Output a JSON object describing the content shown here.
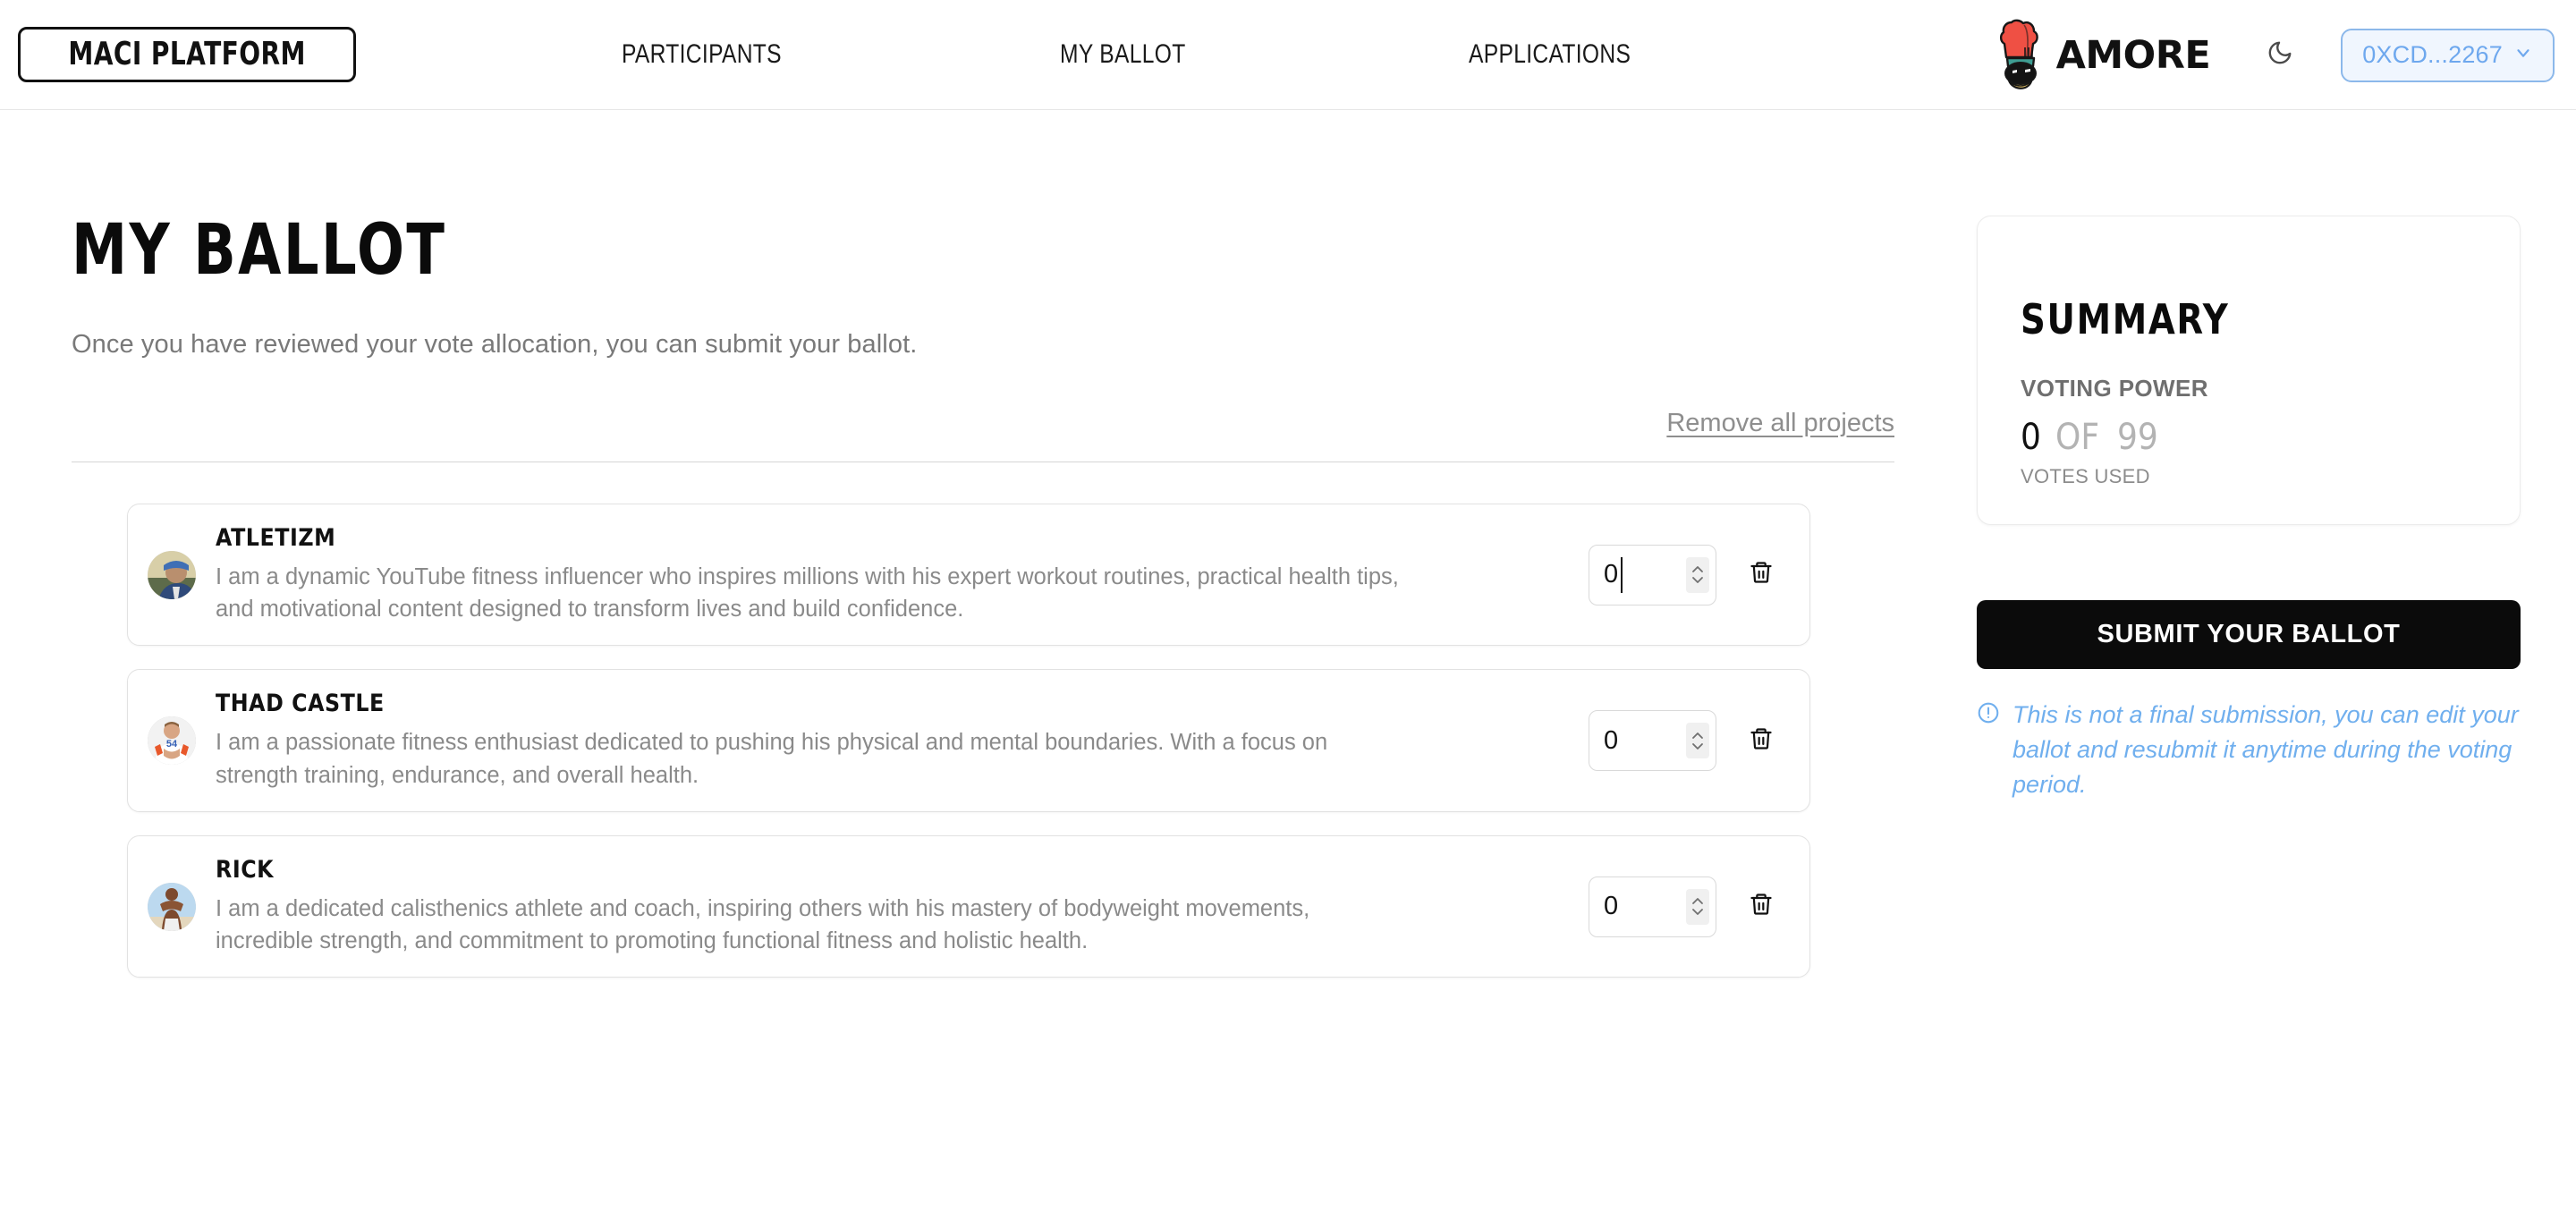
{
  "header": {
    "brand": "MACI PLATFORM",
    "nav": [
      {
        "label": "PARTICIPANTS"
      },
      {
        "label": "MY BALLOT"
      },
      {
        "label": "APPLICATIONS"
      }
    ],
    "logo_text": "AMORE",
    "logo_icon": "duck-chef-icon",
    "theme_toggle_icon": "moon-icon",
    "account": {
      "address": "0XCD...2267",
      "chevron_icon": "chevron-down-icon",
      "text_color": "#6ea8ee",
      "border_color": "#8cb8ea",
      "background_color": "#f0f6fe"
    }
  },
  "main": {
    "title": "MY BALLOT",
    "subtitle": "Once you have reviewed your vote allocation, you can submit your ballot.",
    "remove_all_label": "Remove all projects",
    "projects": [
      {
        "name": "ATLETIZM",
        "description": "I am a dynamic YouTube fitness influencer who inspires millions with his expert workout routines, practical health tips, and motivational content designed to transform lives and build confidence.",
        "votes": "0",
        "focused": true,
        "avatar_icon": "avatar-atletizm",
        "delete_icon": "trash-icon",
        "stepper_icon": "stepper-up-down-icon"
      },
      {
        "name": "THAD CASTLE",
        "description": "I am a passionate fitness enthusiast dedicated to pushing his physical and mental boundaries. With a focus on strength training, endurance, and overall health.",
        "votes": "0",
        "focused": false,
        "avatar_icon": "avatar-thad-castle",
        "delete_icon": "trash-icon",
        "stepper_icon": "stepper-up-down-icon"
      },
      {
        "name": "RICK",
        "description": "I am a dedicated calisthenics athlete and coach, inspiring others with his mastery of bodyweight movements, incredible strength, and commitment to promoting functional fitness and holistic health.",
        "votes": "0",
        "focused": false,
        "avatar_icon": "avatar-rick",
        "delete_icon": "trash-icon",
        "stepper_icon": "stepper-up-down-icon"
      }
    ]
  },
  "summary": {
    "title": "SUMMARY",
    "voting_power_label": "VOTING POWER",
    "votes_used": "0",
    "of_label": "OF",
    "votes_total": "99",
    "votes_used_caption": "VOTES USED",
    "submit_label": "SUBMIT YOUR BALLOT",
    "note_icon": "info-circle-icon",
    "note": "This is not a final submission, you can edit your ballot and resubmit it anytime during the voting period.",
    "note_color": "#70afee",
    "submit_bg": "#0b0b0b"
  }
}
